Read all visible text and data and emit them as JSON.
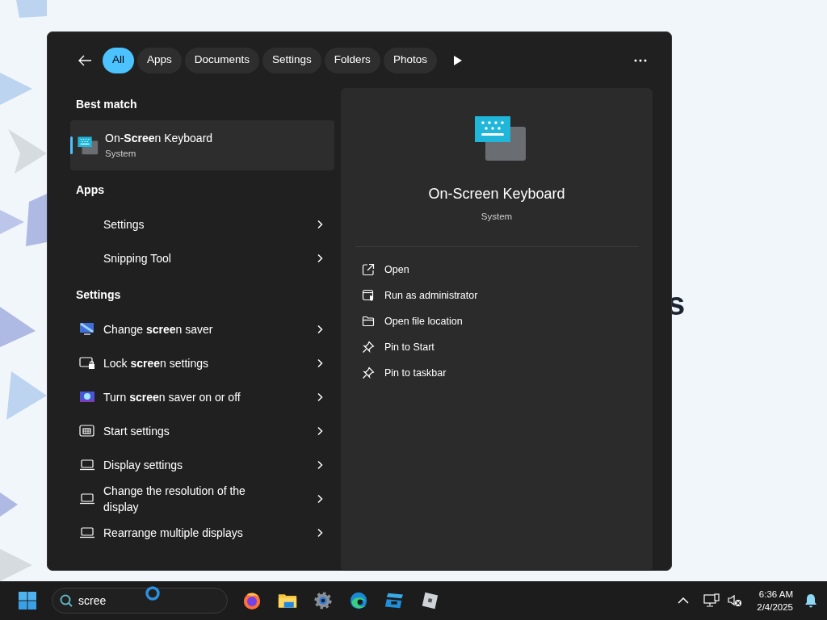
{
  "background": {
    "heading_fragment": "s"
  },
  "search_window": {
    "filters": [
      {
        "label": "All",
        "selected": true
      },
      {
        "label": "Apps",
        "selected": false
      },
      {
        "label": "Documents",
        "selected": false
      },
      {
        "label": "Settings",
        "selected": false
      },
      {
        "label": "Folders",
        "selected": false
      },
      {
        "label": "Photos",
        "selected": false
      }
    ],
    "best_match": {
      "heading": "Best match",
      "name": "On-**Scree**n Keyboard",
      "subtitle": "System",
      "selected": true
    },
    "sections": [
      {
        "heading": "Apps",
        "items": [
          {
            "label": "Settings",
            "kind": "blank"
          },
          {
            "label": "Snipping Tool",
            "kind": "blank"
          }
        ]
      },
      {
        "heading": "Settings",
        "items": [
          {
            "label": "Change **scree**n saver",
            "kind": "monitor"
          },
          {
            "label": "Lock **scree**n settings",
            "kind": "lockscreen"
          },
          {
            "label": "Turn **scree**n saver on or off",
            "kind": "picture"
          },
          {
            "label": "Start settings",
            "kind": "start"
          },
          {
            "label": "Display settings",
            "kind": "laptop"
          },
          {
            "label": "Change the resolution of the display",
            "kind": "laptop"
          },
          {
            "label": "Rearrange multiple displays",
            "kind": "laptop"
          }
        ]
      }
    ],
    "preview": {
      "title": "On-Screen Keyboard",
      "subtitle": "System",
      "actions": [
        {
          "label": "Open",
          "kind": "open"
        },
        {
          "label": "Run as administrator",
          "kind": "admin"
        },
        {
          "label": "Open file location",
          "kind": "folder"
        },
        {
          "label": "Pin to Start",
          "kind": "pin"
        },
        {
          "label": "Pin to taskbar",
          "kind": "pin"
        }
      ]
    }
  },
  "taskbar": {
    "search_value": "scree",
    "apps": [
      {
        "kind": "firefox"
      },
      {
        "kind": "folder"
      },
      {
        "kind": "gear"
      },
      {
        "kind": "edge"
      },
      {
        "kind": "tiles"
      },
      {
        "kind": "cube"
      }
    ],
    "time": "6:36 AM",
    "date": "2/4/2025"
  }
}
